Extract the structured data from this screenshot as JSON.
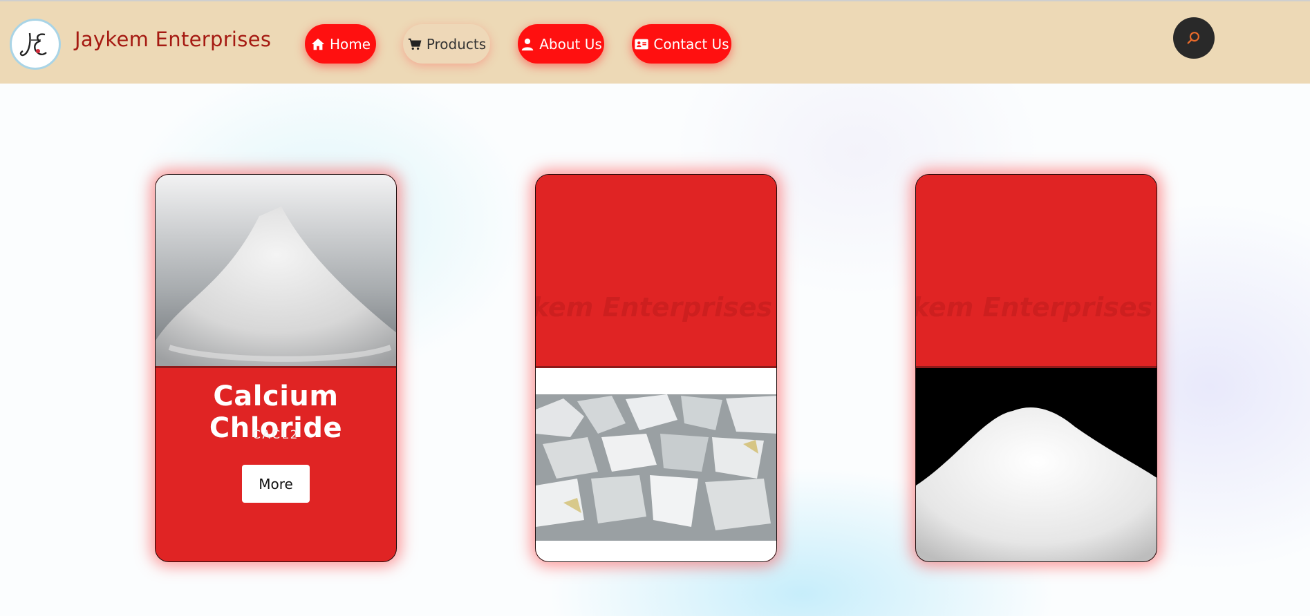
{
  "header": {
    "brand": "Jaykem Enterprises",
    "logo_text": "JE",
    "nav": [
      {
        "label": "Home",
        "icon": "home-icon"
      },
      {
        "label": "Products",
        "icon": "cart-icon"
      },
      {
        "label": "About Us",
        "icon": "user-icon"
      },
      {
        "label": "Contact Us",
        "icon": "contact-card-icon"
      }
    ],
    "active_nav": "Products",
    "search_icon": "search-icon"
  },
  "cards": [
    {
      "title": "Calcium Chloride",
      "subtitle": "CACL2",
      "button": "More",
      "image": "white-powder-pile"
    },
    {
      "watermark": "kem Enterprises",
      "image": "white-rock-chunks"
    },
    {
      "watermark": "kem Enterprises",
      "image": "white-powder-pile-black-bg"
    }
  ],
  "colors": {
    "navbar_bg": "#edd9b6",
    "brand": "#a51a12",
    "nav_button": "#ff1010",
    "card_red": "#e02424",
    "search_bg": "#292929",
    "search_icon": "#e86a2a"
  }
}
